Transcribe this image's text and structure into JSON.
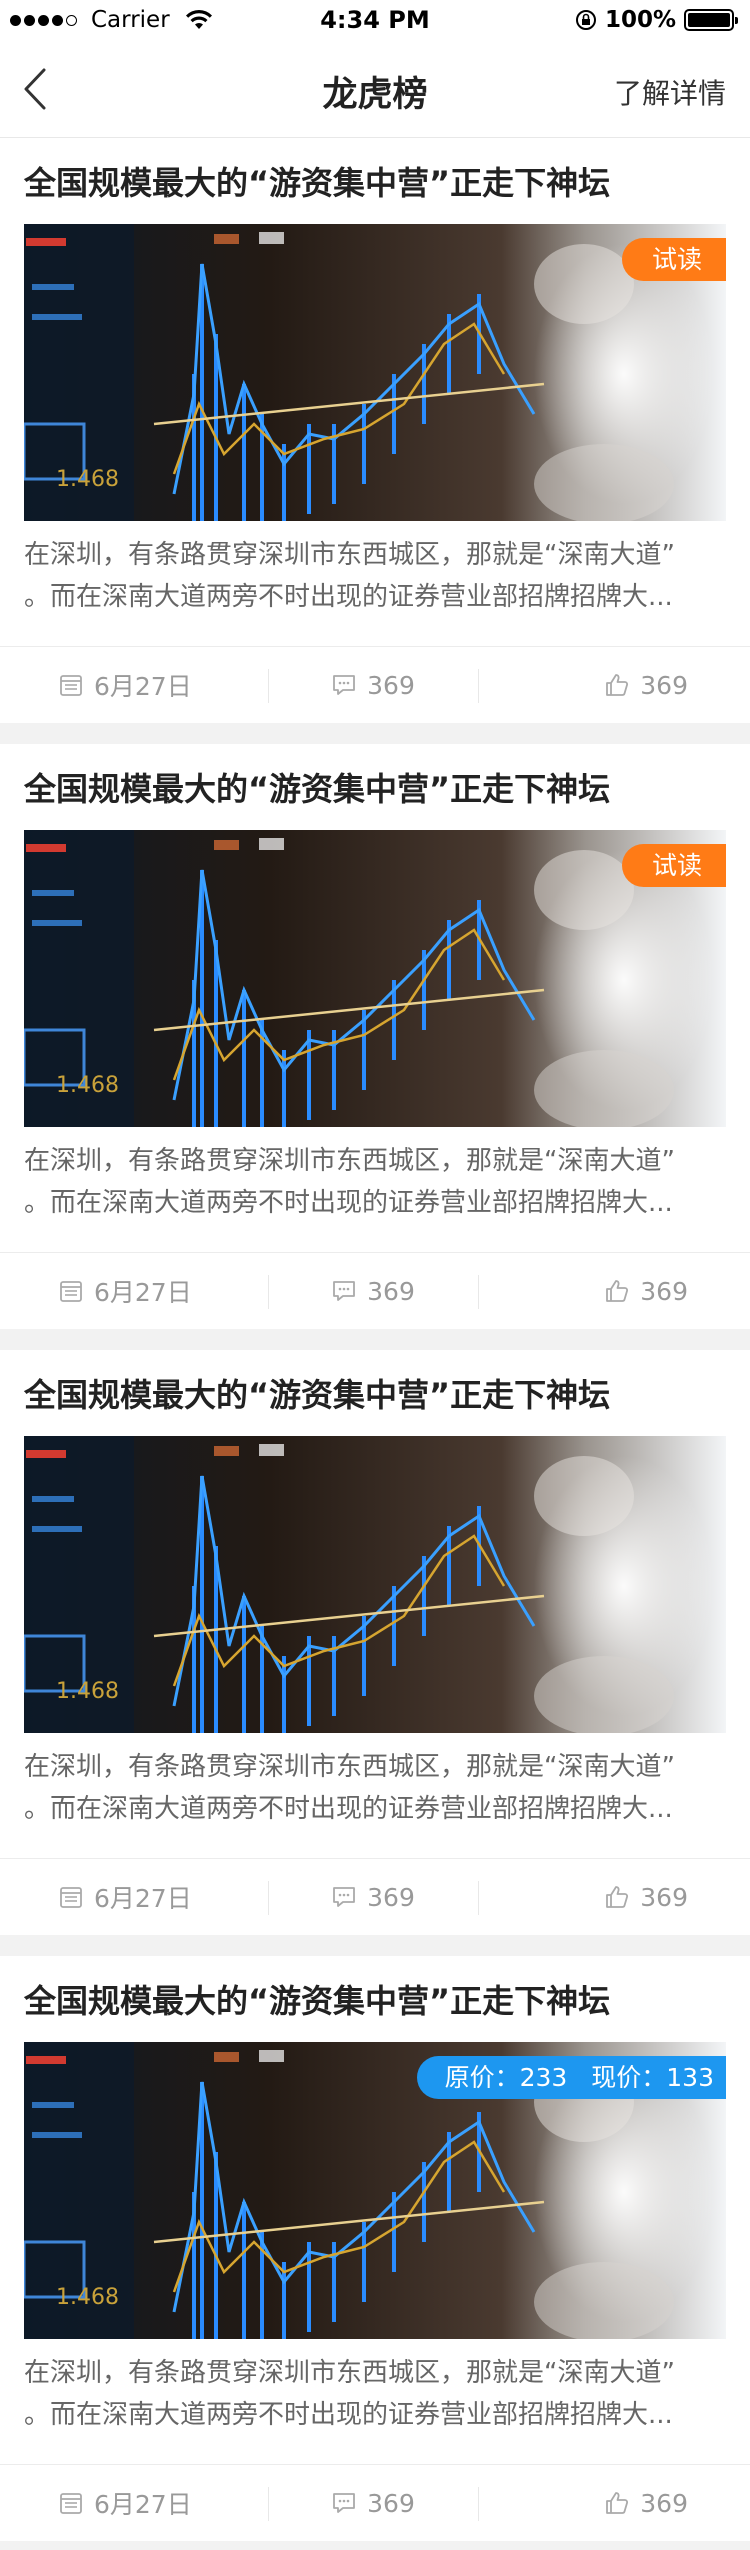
{
  "status_bar": {
    "carrier": "Carrier",
    "time": "4:34 PM",
    "battery": "100%"
  },
  "nav": {
    "title": "龙虎榜",
    "right_label": "了解详情"
  },
  "articles": [
    {
      "title": "全国规模最大的“游资集中营”正走下神坛",
      "badge_type": "trial",
      "badge": "试读",
      "desc_line1": "在深圳，有条路贯穿深圳市东西城区，那就是“深南大道”",
      "desc_line2": "。而在深南大道两旁不时出现的证券营业部招牌招牌大...",
      "date": "6月27日",
      "comments": "369",
      "likes": "369"
    },
    {
      "title": "全国规模最大的“游资集中营”正走下神坛",
      "badge_type": "trial",
      "badge": "试读",
      "desc_line1": "在深圳，有条路贯穿深圳市东西城区，那就是“深南大道”",
      "desc_line2": "。而在深南大道两旁不时出现的证券营业部招牌招牌大...",
      "date": "6月27日",
      "comments": "369",
      "likes": "369"
    },
    {
      "title": "全国规模最大的“游资集中营”正走下神坛",
      "badge_type": "none",
      "desc_line1": "在深圳，有条路贯穿深圳市东西城区，那就是“深南大道”",
      "desc_line2": "。而在深南大道两旁不时出现的证券营业部招牌招牌大...",
      "date": "6月27日",
      "comments": "369",
      "likes": "369"
    },
    {
      "title": "全国规模最大的“游资集中营”正走下神坛",
      "badge_type": "price",
      "original_price": "原价：233",
      "current_price": "现价：133",
      "desc_line1": "在深圳，有条路贯穿深圳市东西城区，那就是“深南大道”",
      "desc_line2": "。而在深南大道两旁不时出现的证券营业部招牌招牌大...",
      "date": "6月27日",
      "comments": "369",
      "likes": "369"
    }
  ],
  "colors": {
    "accent_orange": "#ff7b16",
    "accent_blue": "#1d97f0"
  },
  "icons": {
    "back": "chevron-left-icon",
    "date": "calendar-icon",
    "comments": "comment-icon",
    "likes": "thumbs-up-icon"
  }
}
